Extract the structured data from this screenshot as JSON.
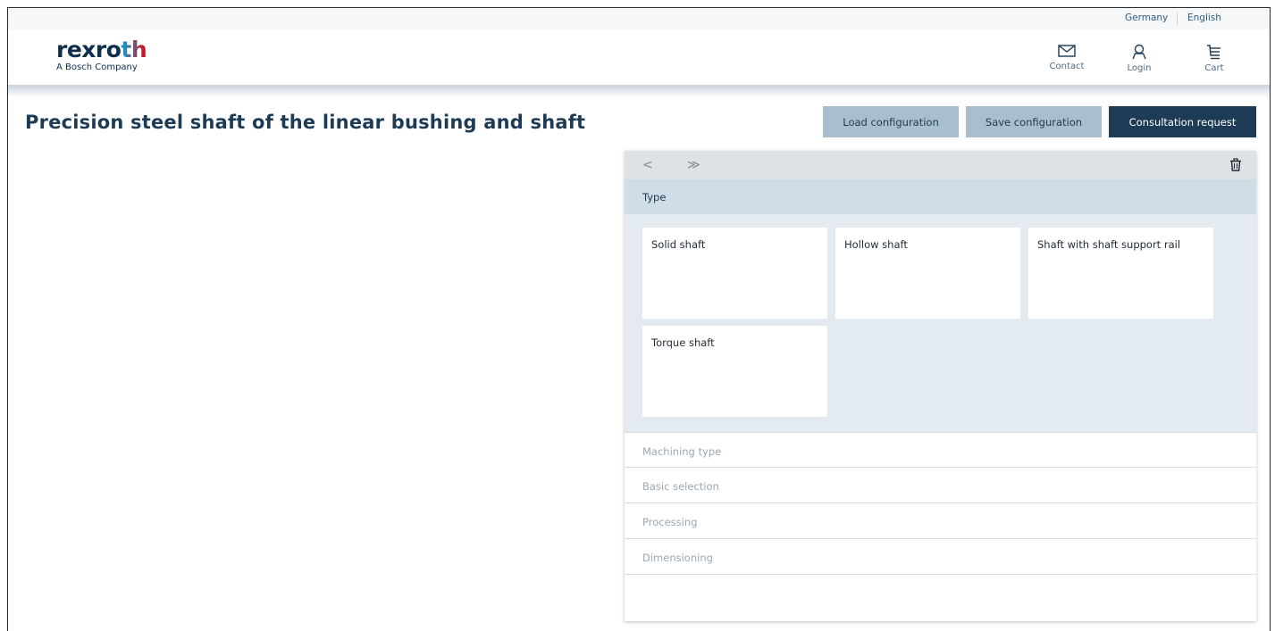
{
  "top_bar": {
    "country": "Germany",
    "language": "English"
  },
  "header": {
    "logo_main": "rexroth",
    "logo_sub": "A Bosch Company",
    "actions": [
      {
        "label": "Contact",
        "icon": "envelope-icon"
      },
      {
        "label": "Login",
        "icon": "user-icon"
      },
      {
        "label": "Cart",
        "icon": "cart-icon"
      }
    ]
  },
  "page": {
    "title": "Precision steel shaft of the linear bushing and shaft"
  },
  "toolbar": {
    "load_label": "Load configuration",
    "save_label": "Save configuration",
    "consult_label": "Consultation request"
  },
  "configurator": {
    "nav_back": "<",
    "nav_forward": "≫",
    "active_section": "Type",
    "options": [
      {
        "label": "Solid shaft"
      },
      {
        "label": "Hollow shaft"
      },
      {
        "label": "Shaft with shaft support rail"
      },
      {
        "label": "Torque shaft"
      }
    ],
    "sections": [
      {
        "label": "Machining type"
      },
      {
        "label": "Basic selection"
      },
      {
        "label": "Processing"
      },
      {
        "label": "Dimensioning"
      }
    ]
  },
  "colors": {
    "brand_dark": "#1d3b55",
    "button_secondary": "#a9bfcd",
    "section_active": "#cfdde6",
    "section_body": "#e3ebf1"
  }
}
